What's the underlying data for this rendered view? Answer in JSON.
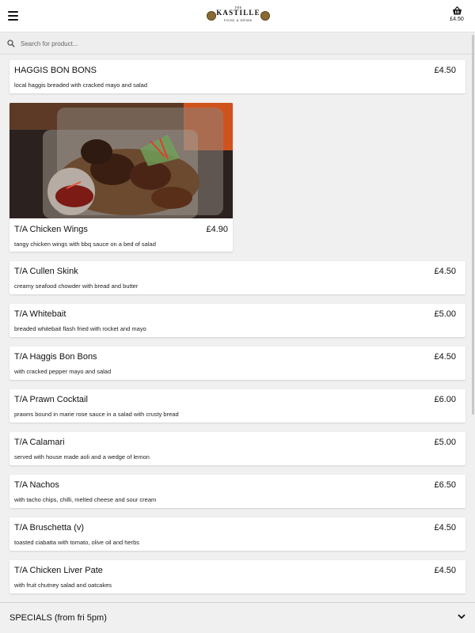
{
  "header": {
    "logo": {
      "the": "THE",
      "name": "KASTILLE",
      "sub": "FOOD & DRINK"
    },
    "cart_total": "£4.50",
    "menu_icon": "hamburger-icon",
    "cart_icon": "basket-icon"
  },
  "search": {
    "placeholder": "Search for product...",
    "value": "",
    "icon": "search-icon"
  },
  "items": [
    {
      "title": "HAGGIS BON BONS",
      "price": "£4.50",
      "desc": "local haggis breaded with cracked mayo and salad"
    },
    {
      "title": "T/A Chicken Wings",
      "price": "£4.90",
      "desc": "tangy chicken wings with bbq sauce on a bed of salad"
    },
    {
      "title": "T/A Cullen Skink",
      "price": "£4.50",
      "desc": "creamy seafood chowder with bread and butter"
    },
    {
      "title": "T/A Whitebait",
      "price": "£5.00",
      "desc": "breaded whitebait flash fried with rocket and mayo"
    },
    {
      "title": "T/A Haggis Bon Bons",
      "price": "£4.50",
      "desc": "with cracked pepper mayo and salad"
    },
    {
      "title": "T/A Prawn Cocktail",
      "price": "£6.00",
      "desc": "prawns bound in marie rose sauce in a salad with crusty bread"
    },
    {
      "title": "T/A Calamari",
      "price": "£5.00",
      "desc": "served with house made aoli and a wedge of lemon"
    },
    {
      "title": "T/A Nachos",
      "price": "£6.50",
      "desc": "with tacho chips, chilli, melted cheese and sour cream"
    },
    {
      "title": "T/A Bruschetta (v)",
      "price": "£4.50",
      "desc": "toasted ciabatta with tomato, olive oil and herbs"
    },
    {
      "title": "T/A Chicken Liver Pate",
      "price": "£4.50",
      "desc": "with fruit chutney salad and oatcakes"
    }
  ],
  "specials": {
    "label": "SPECIALS (from fri 5pm)",
    "icon": "chevron-down-icon"
  },
  "colors": {
    "background": "#f0f0f0",
    "card": "#ffffff",
    "text": "#111111"
  }
}
